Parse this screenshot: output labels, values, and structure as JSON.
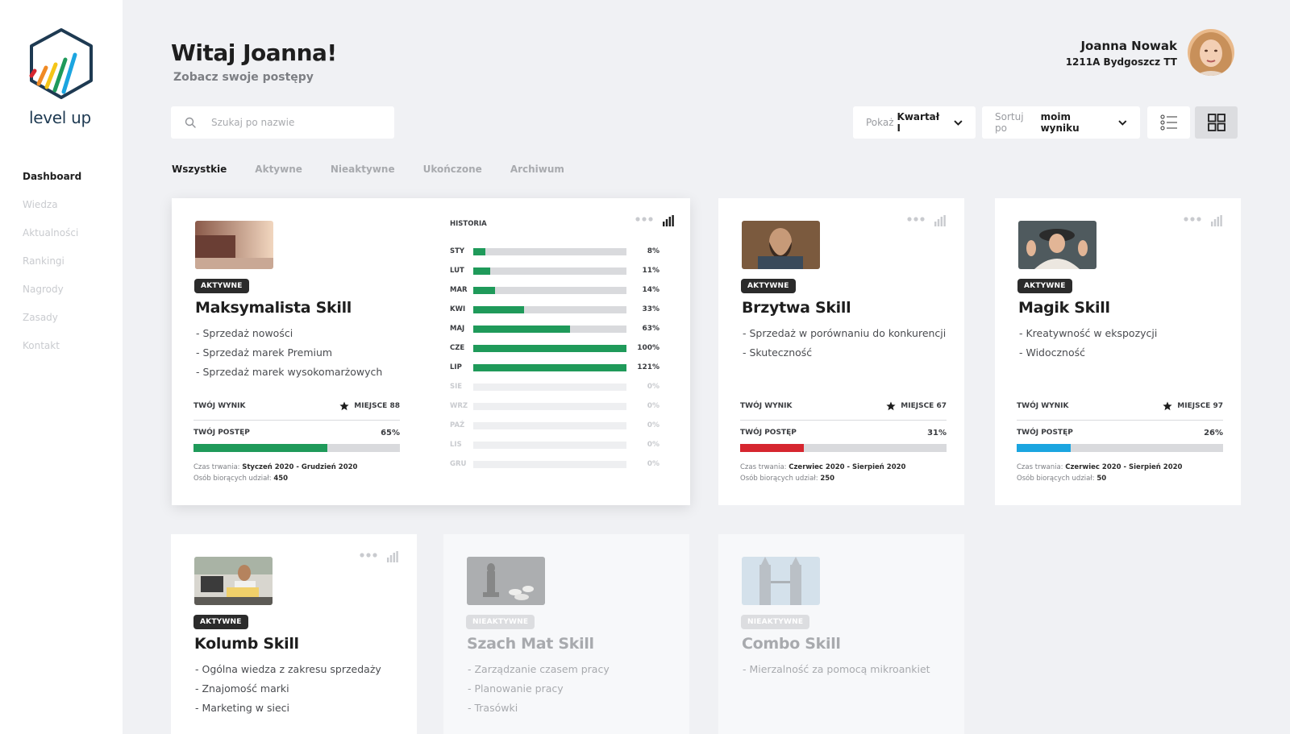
{
  "brand": {
    "name": "level up"
  },
  "nav": [
    "Dashboard",
    "Wiedza",
    "Aktualności",
    "Rankingi",
    "Nagrody",
    "Zasady",
    "Kontakt"
  ],
  "header": {
    "greeting": "Witaj Joanna!",
    "subtitle": "Zobacz swoje postępy"
  },
  "user": {
    "name": "Joanna Nowak",
    "place": "1211A Bydgoszcz TT"
  },
  "search": {
    "placeholder": "Szukaj po nazwie"
  },
  "filters": {
    "show_prefix": "Pokaż",
    "show_value": "Kwartał I",
    "sort_prefix": "Sortuj po",
    "sort_value": "moim wyniku"
  },
  "tabs": [
    "Wszystkie",
    "Aktywne",
    "Nieaktywne",
    "Ukończone",
    "Archiwum"
  ],
  "labels": {
    "score": "TWÓJ WYNIK",
    "progress": "TWÓJ POSTĘP",
    "duration": "Czas trwania:",
    "participants": "Osób biorących udział:",
    "history": "HISTORIA"
  },
  "colors": {
    "green": "#1f9a5a",
    "red": "#d6262f",
    "blue": "#1ba5e0"
  },
  "cards": [
    {
      "status": "AKTYWNE",
      "title": "Maksymalista Skill",
      "items": [
        "- Sprzedaż nowości",
        "- Sprzedaż marek Premium",
        "- Sprzedaż marek wysokomarżowych"
      ],
      "place": "MIEJSCE 88",
      "progress_label": "65%",
      "progress": 0.65,
      "duration": "Styczeń 2020 - Grudzień 2020",
      "participants": "450",
      "history": [
        {
          "month": "STY",
          "label": "8%",
          "value": 8
        },
        {
          "month": "LUT",
          "label": "11%",
          "value": 11
        },
        {
          "month": "MAR",
          "label": "14%",
          "value": 14
        },
        {
          "month": "KWI",
          "label": "33%",
          "value": 33
        },
        {
          "month": "MAJ",
          "label": "63%",
          "value": 63
        },
        {
          "month": "CZE",
          "label": "100%",
          "value": 100
        },
        {
          "month": "LIP",
          "label": "121%",
          "value": 121
        },
        {
          "month": "SIE",
          "label": "0%",
          "value": 0
        },
        {
          "month": "WRZ",
          "label": "0%",
          "value": 0
        },
        {
          "month": "PAŹ",
          "label": "0%",
          "value": 0
        },
        {
          "month": "LIS",
          "label": "0%",
          "value": 0
        },
        {
          "month": "GRU",
          "label": "0%",
          "value": 0
        }
      ]
    },
    {
      "status": "AKTYWNE",
      "title": "Brzytwa Skill",
      "items": [
        "- Sprzedaż w porównaniu do konkurencji",
        "- Skuteczność"
      ],
      "place": "MIEJSCE 67",
      "progress_label": "31%",
      "progress": 0.31,
      "duration": "Czerwiec 2020 - Sierpień 2020",
      "participants": "250"
    },
    {
      "status": "AKTYWNE",
      "title": "Magik Skill",
      "items": [
        "- Kreatywność w ekspozycji",
        "- Widoczność"
      ],
      "place": "MIEJSCE 97",
      "progress_label": "26%",
      "progress": 0.26,
      "duration": "Czerwiec 2020 - Sierpień 2020",
      "participants": "50"
    },
    {
      "status": "AKTYWNE",
      "title": "Kolumb Skill",
      "items": [
        "- Ogólna wiedza z zakresu sprzedaży",
        "- Znajomość marki",
        "- Marketing w sieci"
      ]
    },
    {
      "status": "NIEAKTYWNE",
      "title": "Szach Mat Skill",
      "items": [
        "- Zarządzanie czasem pracy",
        "- Planowanie pracy",
        "- Trasówki"
      ]
    },
    {
      "status": "NIEAKTYWNE",
      "title": "Combo Skill",
      "items": [
        "- Mierzalność za pomocą mikroankiet"
      ]
    }
  ]
}
